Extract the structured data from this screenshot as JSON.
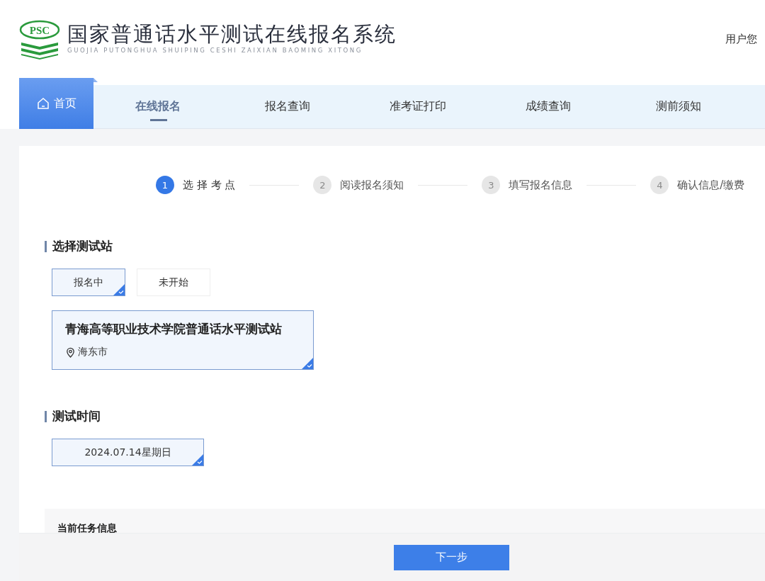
{
  "header": {
    "logo_text": "PSC",
    "title": "国家普通话水平测试在线报名系统",
    "subtitle": "GUOJIA PUTONGHUA SHUIPING CESHI ZAIXIAN BAOMING XITONG",
    "user_greeting": "用户您"
  },
  "nav": [
    {
      "kind": "home",
      "label": "首页",
      "selected": false
    },
    {
      "kind": "tab",
      "label": "在线报名",
      "selected": true
    },
    {
      "kind": "tab",
      "label": "报名查询",
      "selected": false
    },
    {
      "kind": "tab",
      "label": "准考证打印",
      "selected": false
    },
    {
      "kind": "tab",
      "label": "成绩查询",
      "selected": false
    },
    {
      "kind": "tab",
      "label": "测前须知",
      "selected": false
    }
  ],
  "steps": [
    {
      "number": "1",
      "label": "选 择 考 点",
      "selected": true
    },
    {
      "number": "2",
      "label": "阅读报名须知",
      "selected": false
    },
    {
      "number": "3",
      "label": "填写报名信息",
      "selected": false
    },
    {
      "number": "4",
      "label": "确认信息/缴费",
      "selected": false
    }
  ],
  "station_section": {
    "title": "选择测试站",
    "filters": [
      {
        "label": "报名中",
        "selected": true
      },
      {
        "label": "未开始",
        "selected": false
      }
    ],
    "stations": [
      {
        "name": "青海高等职业技术学院普通话水平测试站",
        "location": "海东市",
        "selected": true
      }
    ]
  },
  "time_section": {
    "title": "测试时间",
    "dates": [
      {
        "label": "2024.07.14星期日",
        "selected": true
      }
    ]
  },
  "task_info": {
    "title": "当前任务信息"
  },
  "footer": {
    "next_button": "下一步"
  }
}
